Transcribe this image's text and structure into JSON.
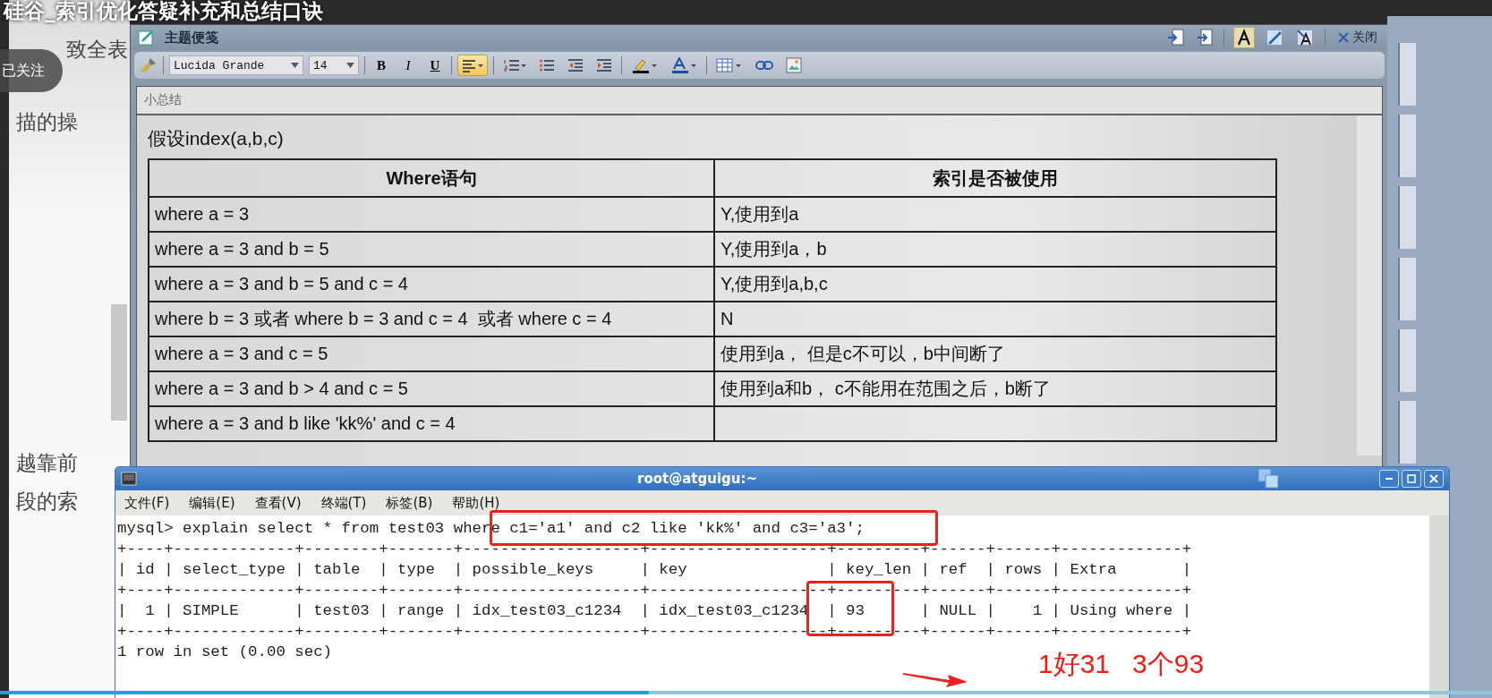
{
  "video_title": "硅谷_索引优化答疑补充和总结口诀",
  "follow_badge": "已关注",
  "left_document": {
    "lines": [
      "致全表",
      "描的操",
      "越靠前",
      "段的索"
    ]
  },
  "note_editor": {
    "title": "主题便笺",
    "close_label": "关闭",
    "font": "Lucida Grande",
    "size": "14",
    "format_buttons": [
      {
        "kind": "bold",
        "label": "B",
        "selected": false
      },
      {
        "kind": "italic",
        "label": "I",
        "selected": false
      },
      {
        "kind": "underline",
        "label": "U",
        "selected": false
      },
      {
        "kind": "align",
        "selected": true
      },
      {
        "kind": "numbered",
        "selected": false
      },
      {
        "kind": "bullets",
        "selected": false
      },
      {
        "kind": "outdent",
        "selected": false
      },
      {
        "kind": "indent",
        "selected": false
      },
      {
        "kind": "highlight",
        "selected": false
      },
      {
        "kind": "fontcolor",
        "selected": false
      },
      {
        "kind": "table",
        "selected": false
      },
      {
        "kind": "link",
        "selected": false
      },
      {
        "kind": "image",
        "selected": false
      }
    ],
    "style_buttons": [
      {
        "kind": "plain",
        "selected": true
      },
      {
        "kind": "pen",
        "selected": false
      },
      {
        "kind": "shaded",
        "selected": false
      }
    ],
    "note_title": "小总结",
    "heading": "假设index(a,b,c)",
    "table": {
      "columns": [
        "Where语句",
        "索引是否被使用"
      ],
      "rows": [
        [
          "where a = 3",
          "Y,使用到a"
        ],
        [
          "where a = 3 and b = 5",
          "Y,使用到a，b"
        ],
        [
          "where a = 3 and b = 5 and c = 4",
          "Y,使用到a,b,c"
        ],
        [
          "where b = 3 或者 where b = 3 and c = 4  或者 where c = 4",
          "N"
        ],
        [
          "where a = 3 and c = 5",
          "使用到a， 但是c不可以，b中间断了"
        ],
        [
          "where a = 3 and b > 4 and c = 5",
          "使用到a和b， c不能用在范围之后，b断了"
        ],
        [
          "where a = 3 and b like 'kk%' and c = 4",
          ""
        ]
      ]
    }
  },
  "terminal": {
    "title": "root@atguigu:~",
    "menus": [
      "文件(F)",
      "编辑(E)",
      "查看(V)",
      "终端(T)",
      "标签(B)",
      "帮助(H)"
    ],
    "lines": [
      "mysql> explain select * from test03 where c1='a1' and c2 like 'kk%' and c3='a3';",
      "+----+-------------+--------+-------+-------------------+-------------------+---------+------+------+-------------+",
      "| id | select_type | table  | type  | possible_keys     | key               | key_len | ref  | rows | Extra       |",
      "+----+-------------+--------+-------+-------------------+-------------------+---------+------+------+-------------+",
      "|  1 | SIMPLE      | test03 | range | idx_test03_c1234  | idx_test03_c1234  | 93      | NULL |    1 | Using where |",
      "+----+-------------+--------+-------+-------------------+-------------------+---------+------+------+-------------+",
      "1 row in set (0.00 sec)"
    ]
  },
  "annotation": "1好31   3个93",
  "progress": {
    "level": 0.435
  }
}
